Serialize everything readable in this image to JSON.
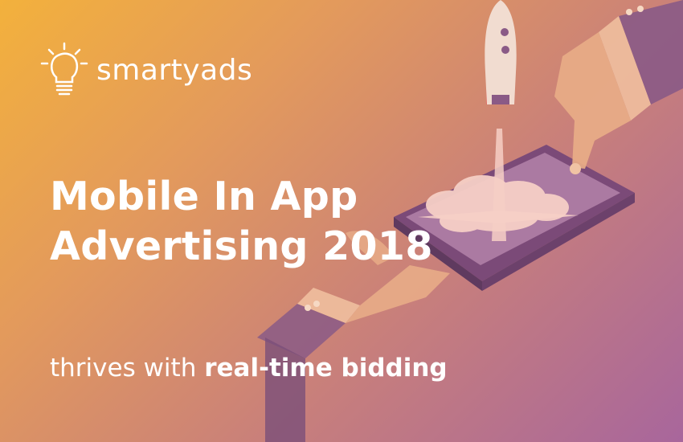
{
  "brand": {
    "name": "smartyads",
    "logo_icon": "lightbulb-icon"
  },
  "headline": {
    "line1": "Mobile In App",
    "line2": "Advertising 2018"
  },
  "tagline": {
    "prefix": "thrives with ",
    "emphasis": "real-time bidding"
  },
  "colors": {
    "gradient_start": "#f3b13c",
    "gradient_end": "#a8669c",
    "text": "#ffffff"
  }
}
